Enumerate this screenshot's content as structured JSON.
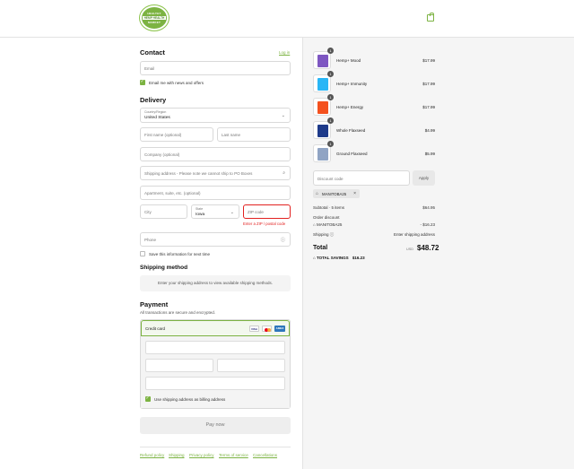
{
  "header": {
    "logo_top": "HEALTHY",
    "logo_mid": "HEMP HEALTH",
    "logo_bottom": "MARKET"
  },
  "contact": {
    "title": "Contact",
    "login_link": "Log in",
    "email_placeholder": "Email",
    "news_label": "Email me with news and offers"
  },
  "delivery": {
    "title": "Delivery",
    "country_label": "Country/Region",
    "country_value": "United States",
    "first_name_placeholder": "First name (optional)",
    "last_name_placeholder": "Last name",
    "company_placeholder": "Company (optional)",
    "address_placeholder": "Shipping address - Please note we cannot ship to PO Boxes",
    "apartment_placeholder": "Apartment, suite, etc. (optional)",
    "city_placeholder": "City",
    "state_label": "State",
    "state_value": "Iowa",
    "zip_placeholder": "ZIP code",
    "zip_error": "Enter a ZIP / postal code",
    "phone_placeholder": "Phone",
    "save_label": "Save this information for next time"
  },
  "shipping_method": {
    "title": "Shipping method",
    "info": "Enter your shipping address to view available shipping methods."
  },
  "payment": {
    "title": "Payment",
    "subtitle": "All transactions are secure and encrypted.",
    "credit_card_label": "Credit card",
    "brands": [
      "VISA",
      "MC",
      "AMEX"
    ],
    "billing_label": "Use shipping address as billing address",
    "pay_button": "Pay now"
  },
  "footer": {
    "links": [
      "Refund policy",
      "Shipping",
      "Privacy policy",
      "Terms of service",
      "Cancellations"
    ]
  },
  "order": {
    "items": [
      {
        "name": "Hemp+ Mood",
        "price": "$17.99",
        "qty": "1",
        "color": "#7e57c2"
      },
      {
        "name": "Hemp+ Immunity",
        "price": "$17.99",
        "qty": "1",
        "color": "#29b6f6"
      },
      {
        "name": "Hemp+ Energy",
        "price": "$17.99",
        "qty": "1",
        "color": "#f4511e"
      },
      {
        "name": "Whole Flaxseed",
        "price": "$4.99",
        "qty": "1",
        "color": "#1e3a8a"
      },
      {
        "name": "Ground Flaxseed",
        "price": "$5.99",
        "qty": "1",
        "color": "#90a4c4"
      }
    ],
    "discount_placeholder": "Discount code",
    "apply_button": "Apply",
    "applied_code": "MANITOBA25",
    "subtotal_label": "Subtotal · 5 items",
    "subtotal_value": "$64.95",
    "order_discount_label": "Order discount",
    "discount_code": "MANITOBA25",
    "discount_value": "- $16.23",
    "shipping_label": "Shipping",
    "shipping_value": "Enter shipping address",
    "total_label": "Total",
    "currency": "USD",
    "total_value": "$48.72",
    "savings_label": "TOTAL SAVINGS",
    "savings_value": "$16.23"
  },
  "colors": {
    "accent": "#7cb342",
    "error": "#e22120"
  }
}
